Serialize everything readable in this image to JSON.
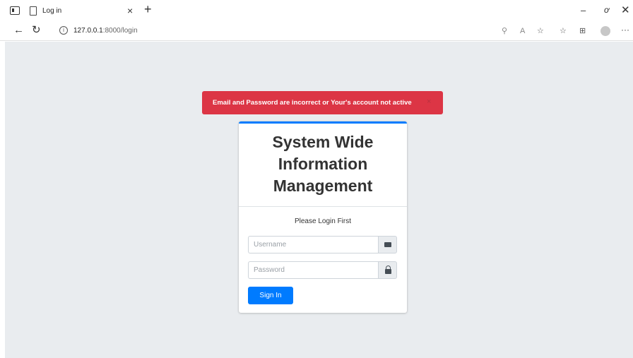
{
  "browser": {
    "tab_title": "Log in",
    "tab_close": "×",
    "new_tab": "+",
    "url_host": "127.0.0.1",
    "url_rest": ":8000/login",
    "window_controls": {
      "minimize": "–",
      "restore": "ơ",
      "close": "✕"
    },
    "toolbar_icons": [
      "zoom-icon",
      "read-aloud-icon",
      "favorite-add-icon",
      "favorites-icon",
      "collections-icon",
      "profile-icon",
      "more-icon"
    ]
  },
  "alert": {
    "message": "Email and Password are incorrect or Your's account not active",
    "close": "×",
    "color": "#dc3545"
  },
  "login_card": {
    "title_lines": [
      "System Wide",
      "Information",
      "Management"
    ],
    "prompt": "Please Login First",
    "username_placeholder": "Username",
    "password_placeholder": "Password",
    "signin_label": "Sign In",
    "accent_color": "#007bff"
  }
}
